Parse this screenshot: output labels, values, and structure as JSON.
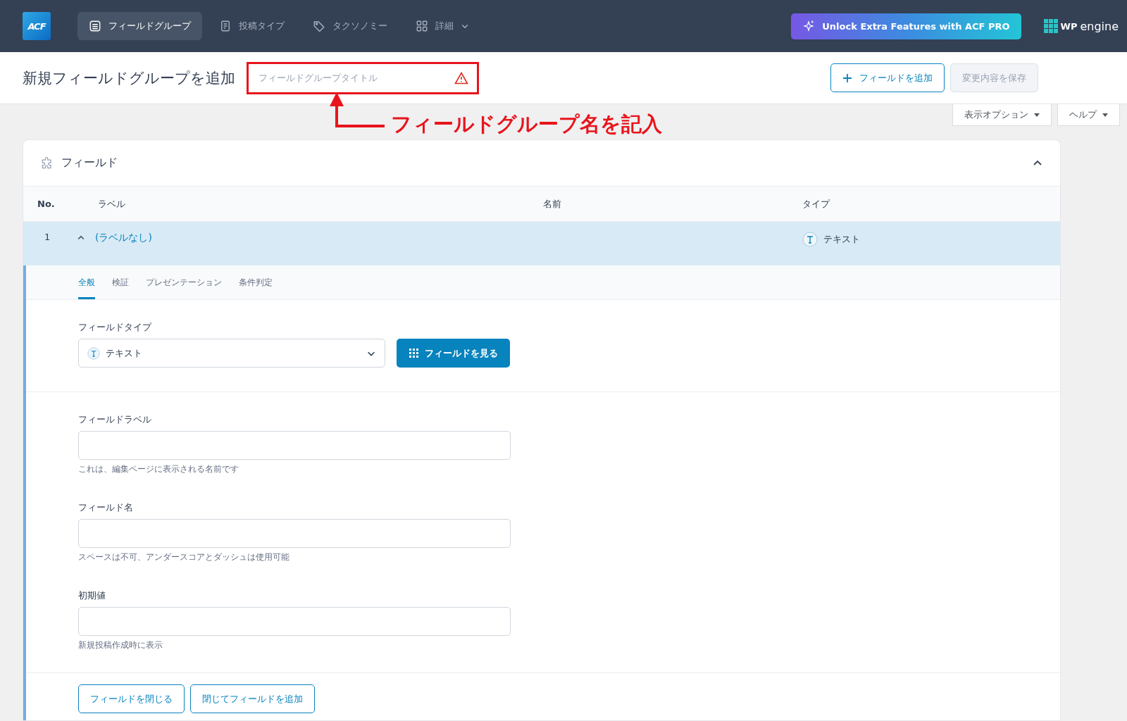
{
  "nav": {
    "logo": "ACF",
    "items": [
      {
        "label": "フィールドグループ",
        "selected": true,
        "dropdown": false
      },
      {
        "label": "投稿タイプ",
        "selected": false,
        "dropdown": false
      },
      {
        "label": "タクソノミー",
        "selected": false,
        "dropdown": false
      },
      {
        "label": "詳細",
        "selected": false,
        "dropdown": true
      }
    ],
    "promo": "Unlock Extra Features with ACF PRO",
    "brand": {
      "mark": "WP",
      "name": "engine"
    }
  },
  "header": {
    "title": "新規フィールドグループを追加",
    "title_input": {
      "placeholder": "フィールドグループタイトル",
      "warning": true,
      "highlighted": true
    },
    "buttons": [
      {
        "label": "フィールドを追加",
        "kind": "outline"
      },
      {
        "label": "変更内容を保存",
        "kind": "disabled"
      }
    ]
  },
  "annotation": {
    "text": "フィールドグループ名を記入"
  },
  "screen_buttons": [
    {
      "label": "表示オプション"
    },
    {
      "label": "ヘルプ"
    }
  ],
  "panel": {
    "title": "フィールド",
    "expanded": true,
    "columns": [
      "No.",
      "ラベル",
      "名前",
      "タイプ"
    ],
    "rows": [
      {
        "number": "1",
        "label": "(ラベルなし)",
        "type": "テキスト",
        "expanded": true
      }
    ]
  },
  "field_tabs": [
    {
      "label": "全般",
      "selected": true
    },
    {
      "label": "検証",
      "selected": false
    },
    {
      "label": "プレゼンテーション",
      "selected": false
    },
    {
      "label": "条件判定",
      "selected": false
    }
  ],
  "field_type": {
    "label": "フィールドタイプ",
    "value": "テキスト",
    "browse_button": "フィールドを見る"
  },
  "inputs": [
    {
      "label": "フィールドラベル",
      "help": "これは、編集ページに表示される名前です"
    },
    {
      "label": "フィールド名",
      "help": "スペースは不可、アンダースコアとダッシュは使用可能"
    },
    {
      "label": "初期値",
      "help": "新規投稿作成時に表示"
    }
  ],
  "footer_buttons": [
    "フィールドを閉じる",
    "閉じてフィールドを追加"
  ]
}
